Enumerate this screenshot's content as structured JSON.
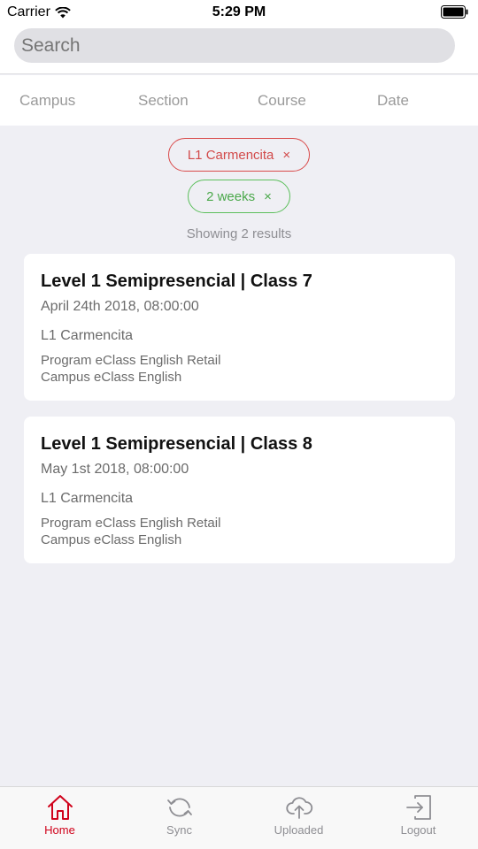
{
  "status_bar": {
    "carrier": "Carrier",
    "time": "5:29 PM"
  },
  "search": {
    "placeholder": "Search"
  },
  "filters": [
    "Campus",
    "Section",
    "Course",
    "Date"
  ],
  "active_filters": [
    {
      "label": "L1 Carmencita",
      "color": "#d94a4a"
    },
    {
      "label": "2 weeks",
      "color": "#5cbf5c"
    }
  ],
  "chip_close_glyph": "×",
  "results_text": "Showing 2 results",
  "cards": [
    {
      "title": "Level 1 Semipresencial | Class 7",
      "date": "April 24th 2018, 08:00:00",
      "course": "L1 Carmencita",
      "program": "Program eClass English Retail",
      "campus": "Campus eClass English"
    },
    {
      "title": "Level 1 Semipresencial | Class 8",
      "date": "May 1st 2018, 08:00:00",
      "course": "L1 Carmencita",
      "program": "Program eClass English Retail",
      "campus": "Campus eClass English"
    }
  ],
  "tabs": [
    {
      "label": "Home",
      "icon": "home-icon",
      "active": true
    },
    {
      "label": "Sync",
      "icon": "sync-icon",
      "active": false
    },
    {
      "label": "Uploaded",
      "icon": "cloud-upload-icon",
      "active": false
    },
    {
      "label": "Logout",
      "icon": "logout-icon",
      "active": false
    }
  ],
  "colors": {
    "accent": "#d0021b",
    "inactive_tab": "#8e8e93",
    "background": "#efeff4"
  }
}
